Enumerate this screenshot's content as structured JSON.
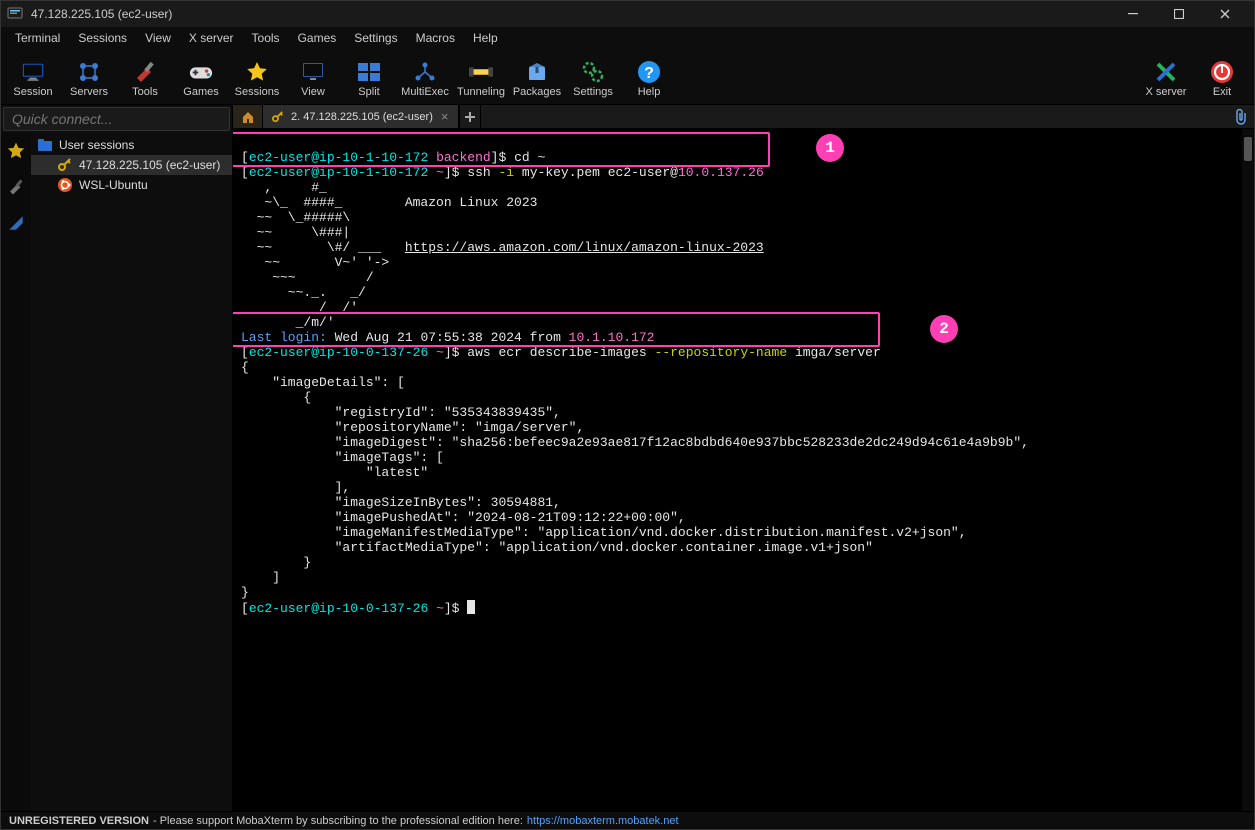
{
  "window": {
    "title": "47.128.225.105 (ec2-user)"
  },
  "menus": [
    "Terminal",
    "Sessions",
    "View",
    "X server",
    "Tools",
    "Games",
    "Settings",
    "Macros",
    "Help"
  ],
  "toolbar": [
    {
      "label": "Session",
      "icon": "monitor"
    },
    {
      "label": "Servers",
      "icon": "servers"
    },
    {
      "label": "Tools",
      "icon": "tools"
    },
    {
      "label": "Games",
      "icon": "games"
    },
    {
      "label": "Sessions",
      "icon": "star"
    },
    {
      "label": "View",
      "icon": "view"
    },
    {
      "label": "Split",
      "icon": "split"
    },
    {
      "label": "MultiExec",
      "icon": "multiexec"
    },
    {
      "label": "Tunneling",
      "icon": "tunnel"
    },
    {
      "label": "Packages",
      "icon": "packages"
    },
    {
      "label": "Settings",
      "icon": "settings"
    },
    {
      "label": "Help",
      "icon": "help"
    }
  ],
  "toolbar_right": [
    {
      "label": "X server",
      "icon": "xserver"
    },
    {
      "label": "Exit",
      "icon": "power"
    }
  ],
  "quick_connect_placeholder": "Quick connect...",
  "tree": {
    "root": "User sessions",
    "items": [
      {
        "label": "47.128.225.105 (ec2-user)",
        "icon": "key",
        "active": true
      },
      {
        "label": "WSL-Ubuntu",
        "icon": "ubuntu",
        "active": false
      }
    ]
  },
  "tabs": {
    "active_index": 1,
    "items": [
      {
        "label": "",
        "icon": "home"
      },
      {
        "label": "2. 47.128.225.105 (ec2-user)",
        "icon": "key"
      }
    ]
  },
  "annotations": {
    "badge1": "1",
    "badge2": "2"
  },
  "terminal": {
    "prompt1_user": "ec2-user@ip-10-1-10-172",
    "prompt1_dir": "backend",
    "prompt1_cmd": "cd ~",
    "prompt2_user": "ec2-user@ip-10-1-10-172",
    "prompt2_dir": "~",
    "prompt2_cmd": "ssh ",
    "prompt2_flag": "-i",
    "prompt2_rest": " my-key.pem ec2-user@",
    "prompt2_ip": "10.0.137.26",
    "ascii_l1": "   ,     #_",
    "ascii_l2": "   ~\\_  ####_        Amazon Linux 2023",
    "ascii_l3": "  ~~  \\_#####\\",
    "ascii_l4": "  ~~     \\###|",
    "ascii_l5": "  ~~       \\#/ ___   ",
    "url": "https://aws.amazon.com/linux/amazon-linux-2023",
    "ascii_l6": "   ~~       V~' '->",
    "ascii_l7": "    ~~~         /",
    "ascii_l8": "      ~~._.   _/",
    "ascii_l9": "         _/ _/'",
    "ascii_l10": "       _/m/'",
    "last_login_label": "Last login:",
    "last_login_rest": " Wed Aug 21 07:55:38 2024 from ",
    "last_login_ip": "10.1.10.172",
    "prompt3_user": "ec2-user@ip-10-0-137-26",
    "prompt3_dir": "~",
    "prompt3_cmd": "aws ecr describe-images ",
    "prompt3_flag": "--repository-name",
    "prompt3_arg": " imga/server",
    "json_open": "{",
    "json_l1": "    \"imageDetails\": [",
    "json_l2": "        {",
    "json_l3": "            \"registryId\": \"535343839435\",",
    "json_l4": "            \"repositoryName\": \"imga/server\",",
    "json_l5": "            \"imageDigest\": \"sha256:befeec9a2e93ae817f12ac8bdbd640e937bbc528233de2dc249d94c61e4a9b9b\",",
    "json_l6": "            \"imageTags\": [",
    "json_l7": "                \"latest\"",
    "json_l8": "            ],",
    "json_l9": "            \"imageSizeInBytes\": 30594881,",
    "json_l10": "            \"imagePushedAt\": \"2024-08-21T09:12:22+00:00\",",
    "json_l11": "            \"imageManifestMediaType\": \"application/vnd.docker.distribution.manifest.v2+json\",",
    "json_l12": "            \"artifactMediaType\": \"application/vnd.docker.container.image.v1+json\"",
    "json_l13": "        }",
    "json_l14": "    ]",
    "json_close": "}",
    "prompt4_user": "ec2-user@ip-10-0-137-26",
    "prompt4_dir": "~"
  },
  "status": {
    "bold": "UNREGISTERED VERSION",
    "text": " - Please support MobaXterm by subscribing to the professional edition here: ",
    "url": "https://mobaxterm.mobatek.net"
  }
}
